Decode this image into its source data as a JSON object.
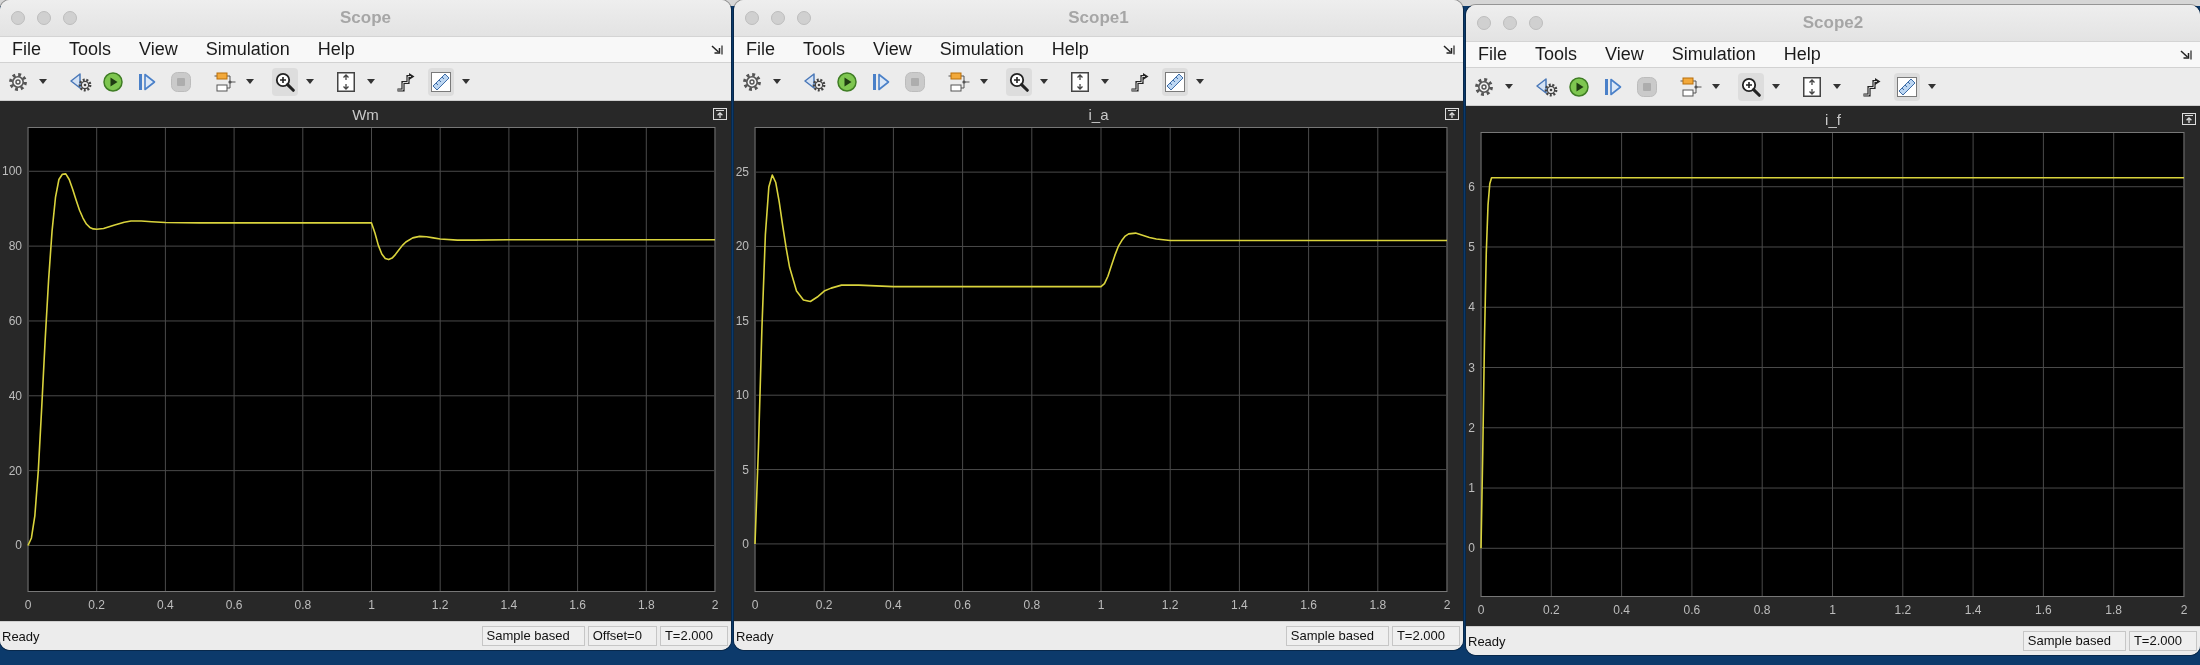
{
  "windows": [
    {
      "title": "Scope",
      "menu": [
        "File",
        "Tools",
        "View",
        "Simulation",
        "Help"
      ],
      "toolbar": [
        {
          "kind": "settings",
          "dropdown": true,
          "disabled": false
        },
        {
          "kind": "step-back",
          "dropdown": false,
          "disabled": false
        },
        {
          "kind": "run",
          "dropdown": false,
          "disabled": false
        },
        {
          "kind": "step-forward",
          "dropdown": false,
          "disabled": false
        },
        {
          "kind": "stop",
          "dropdown": false,
          "disabled": true
        },
        {
          "kind": "highlight",
          "dropdown": true,
          "disabled": false
        },
        {
          "kind": "zoom",
          "dropdown": true,
          "disabled": false
        },
        {
          "kind": "scale",
          "dropdown": true,
          "disabled": false
        },
        {
          "kind": "triggers",
          "dropdown": false,
          "disabled": false
        },
        {
          "kind": "measure",
          "dropdown": true,
          "disabled": false
        }
      ],
      "plot": {
        "chart_data": {
          "type": "line",
          "title": "Wm",
          "x": [
            0,
            0.01,
            0.02,
            0.03,
            0.04,
            0.05,
            0.06,
            0.07,
            0.08,
            0.09,
            0.1,
            0.11,
            0.12,
            0.13,
            0.14,
            0.15,
            0.16,
            0.17,
            0.18,
            0.19,
            0.2,
            0.22,
            0.25,
            0.28,
            0.3,
            0.33,
            0.36,
            0.4,
            0.5,
            1,
            1.01,
            1.02,
            1.03,
            1.04,
            1.05,
            1.06,
            1.07,
            1.08,
            1.09,
            1.1,
            1.12,
            1.14,
            1.16,
            1.18,
            1.2,
            1.25,
            1.3,
            1.4,
            2
          ],
          "series": [
            {
              "color": "#d9d33c",
              "values": [
                0,
                2,
                8,
                20,
                37,
                55,
                71,
                84,
                93,
                97.8,
                99.2,
                99.3,
                97.8,
                95.2,
                92.3,
                89.6,
                87.5,
                85.9,
                85,
                84.6,
                84.5,
                84.7,
                85.6,
                86.4,
                86.7,
                86.7,
                86.5,
                86.3,
                86.2,
                86.2,
                83.5,
                80.2,
                77.9,
                76.7,
                76.4,
                76.8,
                77.8,
                79,
                80.2,
                81.1,
                82.2,
                82.6,
                82.5,
                82.2,
                81.9,
                81.6,
                81.6,
                81.7,
                81.7
              ]
            }
          ],
          "xlim": [
            0,
            2
          ],
          "ylim": [
            -12.3,
            111.7
          ],
          "xticks": [
            0,
            0.2,
            0.4,
            0.6,
            0.8,
            1,
            1.2,
            1.4,
            1.6,
            1.8,
            2
          ],
          "yticks": [
            0,
            20,
            40,
            60,
            80,
            100
          ],
          "grid": true
        }
      },
      "status_bar": {
        "text": "Ready",
        "fields": [
          "Sample based",
          "Offset=0",
          "T=2.000"
        ]
      }
    },
    {
      "title": "Scope1",
      "menu": [
        "File",
        "Tools",
        "View",
        "Simulation",
        "Help"
      ],
      "toolbar": [
        {
          "kind": "settings",
          "dropdown": true,
          "disabled": false
        },
        {
          "kind": "step-back",
          "dropdown": false,
          "disabled": false
        },
        {
          "kind": "run",
          "dropdown": false,
          "disabled": false
        },
        {
          "kind": "step-forward",
          "dropdown": false,
          "disabled": false
        },
        {
          "kind": "stop",
          "dropdown": false,
          "disabled": true
        },
        {
          "kind": "highlight",
          "dropdown": true,
          "disabled": false
        },
        {
          "kind": "zoom",
          "dropdown": true,
          "disabled": false
        },
        {
          "kind": "scale",
          "dropdown": true,
          "disabled": false
        },
        {
          "kind": "triggers",
          "dropdown": false,
          "disabled": false
        },
        {
          "kind": "measure",
          "dropdown": true,
          "disabled": false
        }
      ],
      "plot": {
        "chart_data": {
          "type": "line",
          "title": "i_a",
          "x": [
            0,
            0.01,
            0.02,
            0.03,
            0.04,
            0.05,
            0.06,
            0.07,
            0.08,
            0.09,
            0.1,
            0.12,
            0.14,
            0.16,
            0.18,
            0.2,
            0.22,
            0.25,
            0.3,
            0.4,
            1,
            1.01,
            1.02,
            1.03,
            1.04,
            1.05,
            1.06,
            1.07,
            1.08,
            1.1,
            1.12,
            1.14,
            1.16,
            1.2,
            1.3,
            2
          ],
          "series": [
            {
              "color": "#d9d33c",
              "values": [
                0,
                6.5,
                14.5,
                20.8,
                24,
                24.8,
                24.3,
                23,
                21.4,
                19.9,
                18.6,
                17,
                16.4,
                16.3,
                16.6,
                17,
                17.2,
                17.4,
                17.4,
                17.3,
                17.3,
                17.5,
                18,
                18.7,
                19.4,
                20,
                20.4,
                20.7,
                20.85,
                20.9,
                20.75,
                20.6,
                20.5,
                20.4,
                20.4,
                20.4
              ]
            }
          ],
          "xlim": [
            0,
            2
          ],
          "ylim": [
            -3.2,
            28
          ],
          "xticks": [
            0,
            0.2,
            0.4,
            0.6,
            0.8,
            1,
            1.2,
            1.4,
            1.6,
            1.8,
            2
          ],
          "yticks": [
            0,
            5,
            10,
            15,
            20,
            25
          ],
          "grid": true
        }
      },
      "status_bar": {
        "text": "Ready",
        "fields": [
          "Sample based",
          "T=2.000"
        ]
      }
    },
    {
      "title": "Scope2",
      "menu": [
        "File",
        "Tools",
        "View",
        "Simulation",
        "Help"
      ],
      "toolbar": [
        {
          "kind": "settings",
          "dropdown": true,
          "disabled": false
        },
        {
          "kind": "step-back",
          "dropdown": false,
          "disabled": false
        },
        {
          "kind": "run",
          "dropdown": false,
          "disabled": false
        },
        {
          "kind": "step-forward",
          "dropdown": false,
          "disabled": false
        },
        {
          "kind": "stop",
          "dropdown": false,
          "disabled": true
        },
        {
          "kind": "highlight",
          "dropdown": true,
          "disabled": false
        },
        {
          "kind": "zoom",
          "dropdown": true,
          "disabled": false
        },
        {
          "kind": "scale",
          "dropdown": true,
          "disabled": false
        },
        {
          "kind": "triggers",
          "dropdown": false,
          "disabled": false
        },
        {
          "kind": "measure",
          "dropdown": true,
          "disabled": false
        }
      ],
      "plot": {
        "chart_data": {
          "type": "line",
          "title": "i_f",
          "x": [
            0,
            0.005,
            0.01,
            0.015,
            0.02,
            0.025,
            0.03,
            0.04,
            2
          ],
          "series": [
            {
              "color": "#d9d33c",
              "values": [
                0,
                1.6,
                3.5,
                4.9,
                5.7,
                6.05,
                6.15,
                6.15,
                6.15
              ]
            }
          ],
          "xlim": [
            0,
            2
          ],
          "ylim": [
            -0.8,
            6.9
          ],
          "xticks": [
            0,
            0.2,
            0.4,
            0.6,
            0.8,
            1,
            1.2,
            1.4,
            1.6,
            1.8,
            2
          ],
          "yticks": [
            0,
            1,
            2,
            3,
            4,
            5,
            6
          ],
          "grid": true
        }
      },
      "status_bar": {
        "text": "Ready",
        "fields": [
          "Sample based",
          "T=2.000"
        ]
      }
    }
  ]
}
